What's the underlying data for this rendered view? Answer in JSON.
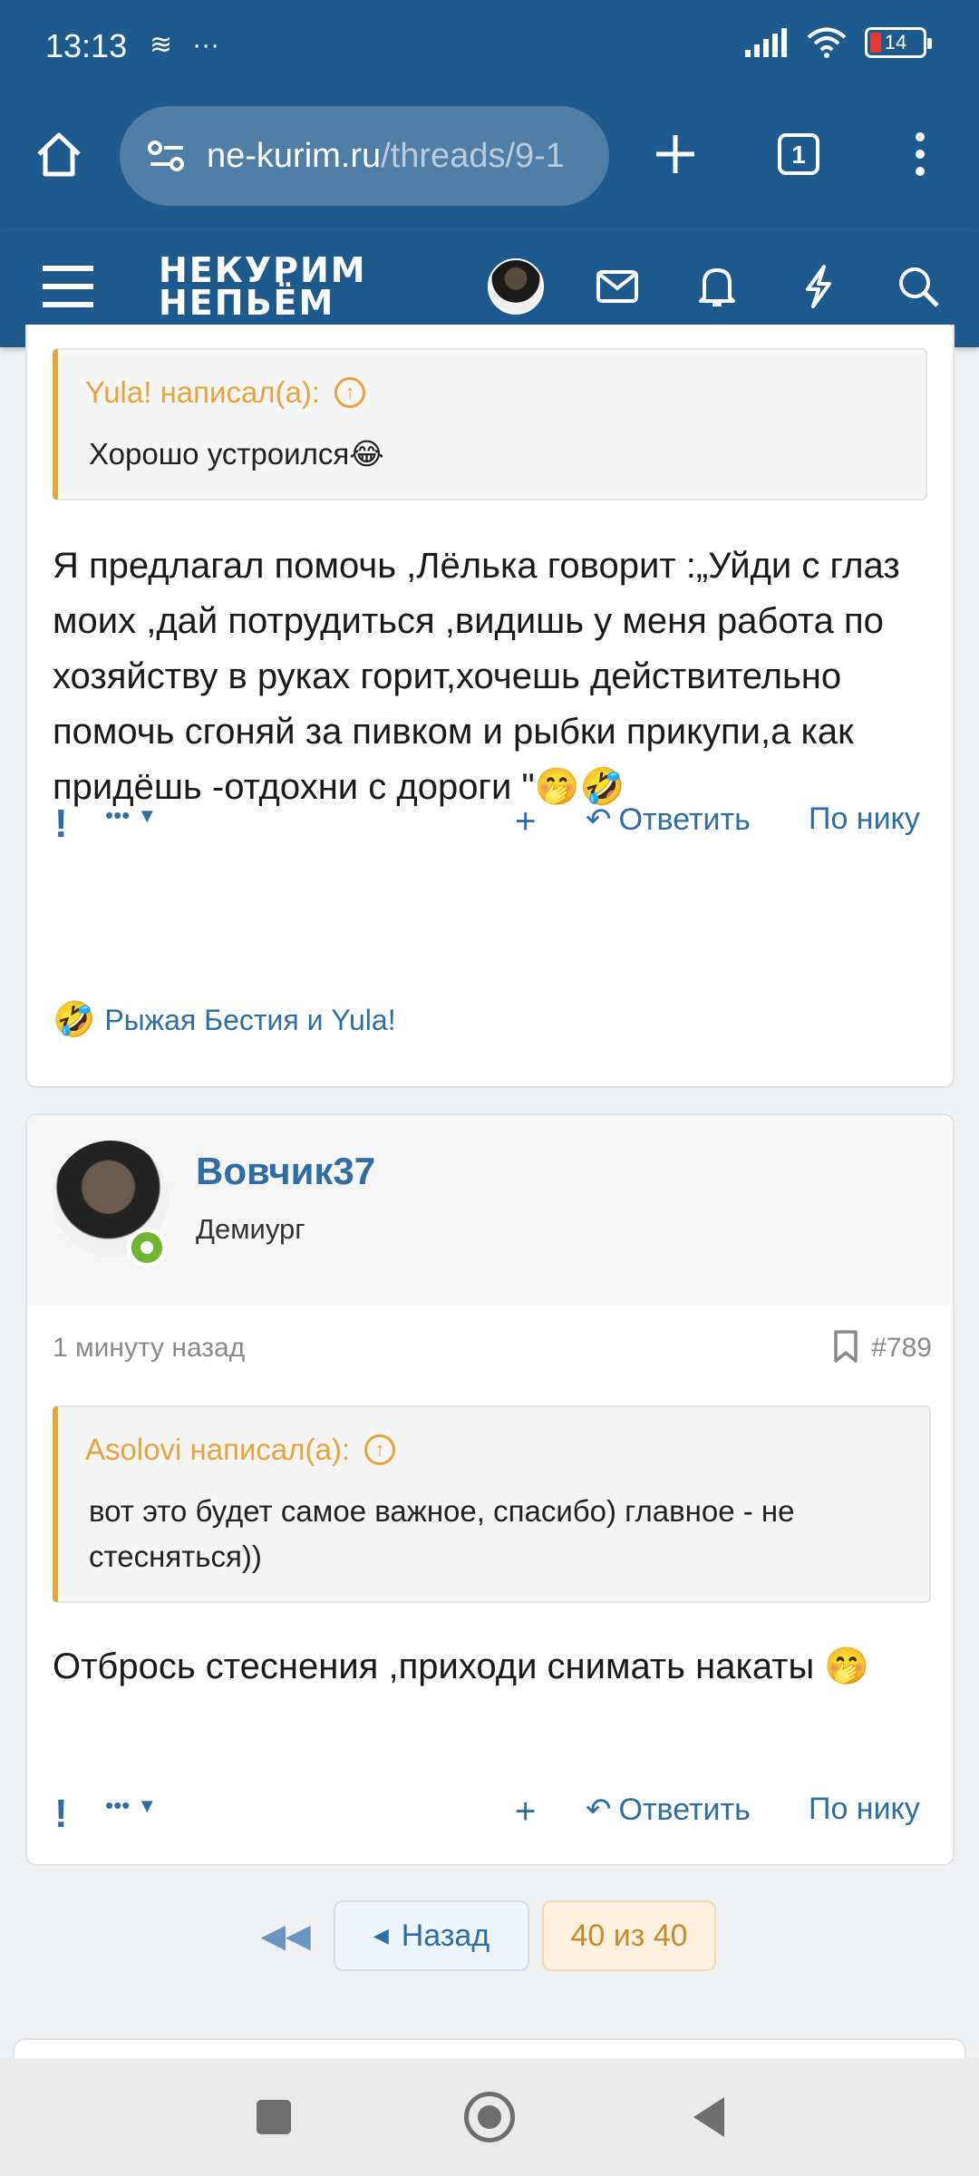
{
  "status_bar": {
    "time": "13:13",
    "battery": "14"
  },
  "browser": {
    "url_domain": "ne-kurim.ru",
    "url_path": "/threads/9-1",
    "tab_count": "1"
  },
  "forum": {
    "logo_line1": "НЕКУРИМ",
    "logo_line2": "НЕПЬЁМ"
  },
  "post1": {
    "quote_author": "Yula! написал(а):",
    "quote_text": "Хорошо устроился😂",
    "text": "Я предлагал помочь ,Лёлька говорит :„Уйди с глаз моих ,дай потрудиться ,видишь у меня работа по хозяйству в руках горит,хочешь действительно помочь сгоняй за пивком и рыбки прикупи,а как придёшь -отдохни с дороги \"🤭🤣",
    "actions": {
      "report": "!",
      "more": "•••",
      "add": "+",
      "reply": "Ответить",
      "by_nick": "По нику"
    },
    "reactions_emoji": "🤣",
    "reactions_text": "Рыжая Бестия и Yula!"
  },
  "post2": {
    "username": "Вовчик37",
    "user_title": "Демиург",
    "time": "1 минуту назад",
    "number": "#789",
    "quote_author": "Asolovi написал(а):",
    "quote_text": "вот это будет самое важное, спасибо) главное - не стесняться))",
    "text": "Отбрось стеснения ,приходи снимать накаты 🤭",
    "actions": {
      "report": "!",
      "more": "•••",
      "add": "+",
      "reply": "Ответить",
      "by_nick": "По нику"
    }
  },
  "pagination": {
    "back_label": "Назад",
    "current": "40 из 40"
  }
}
